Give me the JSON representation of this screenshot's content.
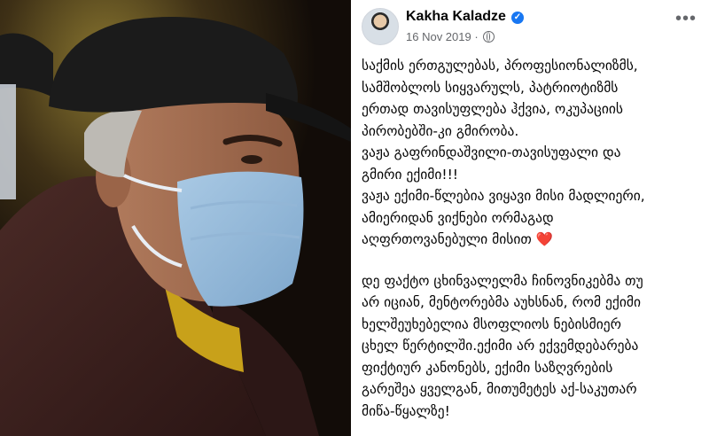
{
  "post": {
    "author": "Kakha Kaladze",
    "date": "16 Nov 2019",
    "separator": "·",
    "verified_icon": "verified-badge-icon",
    "privacy_icon": "globe-icon",
    "more_label": "•••",
    "paragraphs": [
      [
        "საქმის ერთგულებას, პროფესიონალიზმს,",
        "სამშობლოს სიყვარულს, პატრიოტიზმს",
        "ერთად თავისუფლება ჰქვია, ოკუპაციის",
        "პირობებში-კი გმირობა.",
        "ვაჟა გაფრინდაშვილი-თავისუფალი და",
        "გმირი  ექიმი!!!",
        "ვაჟა ექიმი-წლებია ვიყავი მისი მადლიერი,",
        "ამიერიდან ვიქნები ორმაგად",
        "აღფრთოვანებული მისით"
      ],
      [
        "დე ფაქტო ცხინვალელმა ჩინოვნიკებმა თუ",
        "არ იციან, მენტორებმა აუხსნან, რომ ექიმი",
        "ხელშეუხებელია მსოფლიოს ნებისმიერ",
        "ცხელ წერტილში.ექიმი არ ექვემდებარება",
        "ფიქტიურ კანონებს, ექიმი საზღვრების",
        "გარეშეა ყველგან, მითუმეტეს აქ-საკუთარ",
        "მიწა-წყალზე!"
      ]
    ],
    "heart": "❤️"
  },
  "colors": {
    "name": "#050505",
    "meta": "#65676b",
    "verified": "#1877f2",
    "heart": "#e0245e"
  }
}
